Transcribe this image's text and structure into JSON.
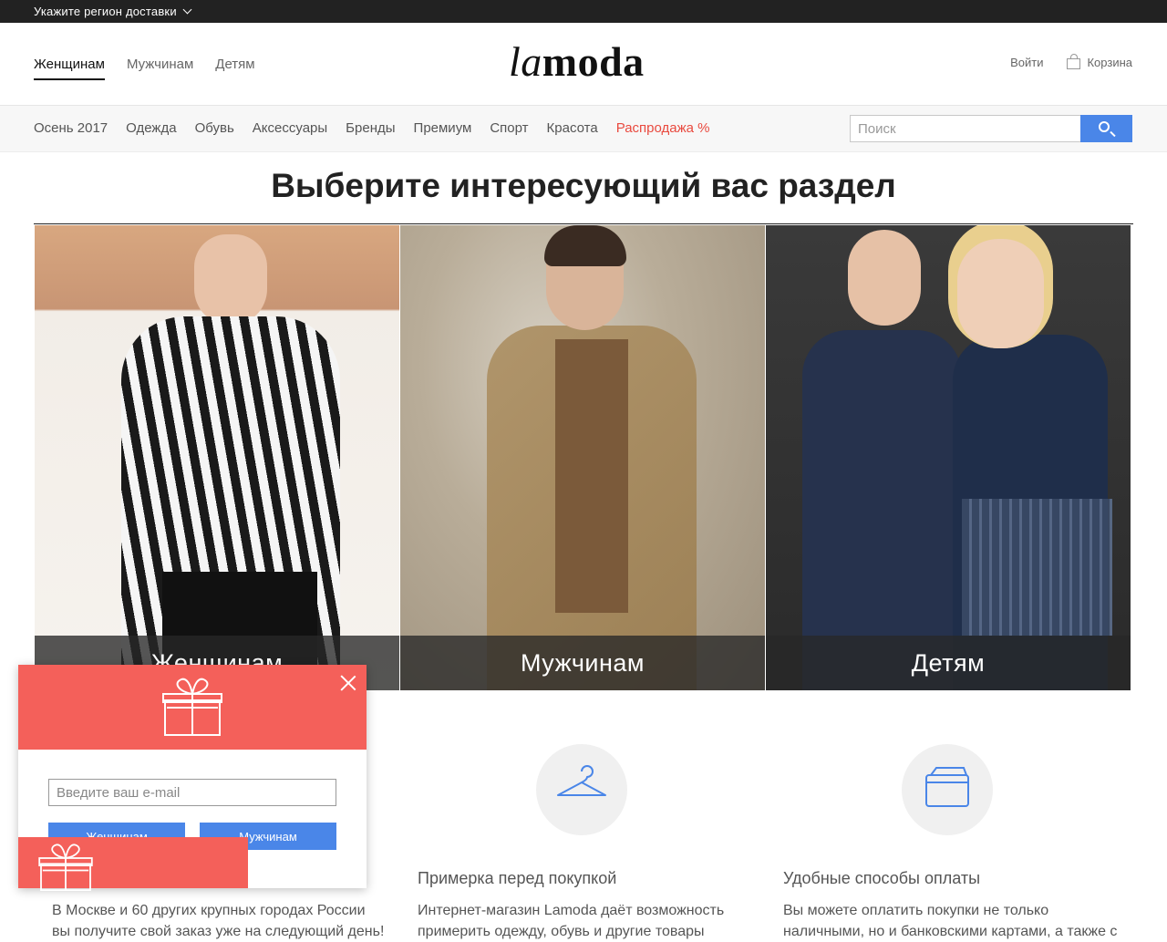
{
  "topbar": {
    "region_label": "Укажите регион доставки"
  },
  "header": {
    "gender_tabs": [
      {
        "label": "Женщинам",
        "active": true
      },
      {
        "label": "Мужчинам",
        "active": false
      },
      {
        "label": "Детям",
        "active": false
      }
    ],
    "logo": {
      "la": "la",
      "moda": "moda"
    },
    "login_label": "Войти",
    "cart_label": "Корзина"
  },
  "catnav": {
    "items": [
      "Осень 2017",
      "Одежда",
      "Обувь",
      "Аксессуары",
      "Бренды",
      "Премиум",
      "Спорт",
      "Красота"
    ],
    "sale_label": "Распродажа %",
    "search_placeholder": "Поиск"
  },
  "main": {
    "heading": "Выберите интересующий вас раздел",
    "sections": [
      {
        "label": "Женщинам"
      },
      {
        "label": "Мужчинам"
      },
      {
        "label": "Детям"
      }
    ]
  },
  "features": [
    {
      "title": "",
      "text": [
        "В Москве и 60 других крупных городах России",
        "вы получите свой заказ уже на следующий день!"
      ]
    },
    {
      "title": "Примерка перед покупкой",
      "text": [
        "Интернет-магазин Lamoda даёт возможность",
        "примерить одежду, обувь и другие товары"
      ]
    },
    {
      "title": "Удобные способы оплаты",
      "text": [
        "Вы можете оплатить покупки не только",
        "наличными, но и банковскими картами, а также с"
      ]
    }
  ],
  "popup": {
    "email_placeholder": "Введите ваш e-mail",
    "women_button": "Женщинам",
    "men_button": "Мужчинам"
  },
  "colors": {
    "accent_blue": "#4a86e8",
    "sale_red": "#e94a3f",
    "popup_red": "#f4605a",
    "topbar": "#222222"
  }
}
